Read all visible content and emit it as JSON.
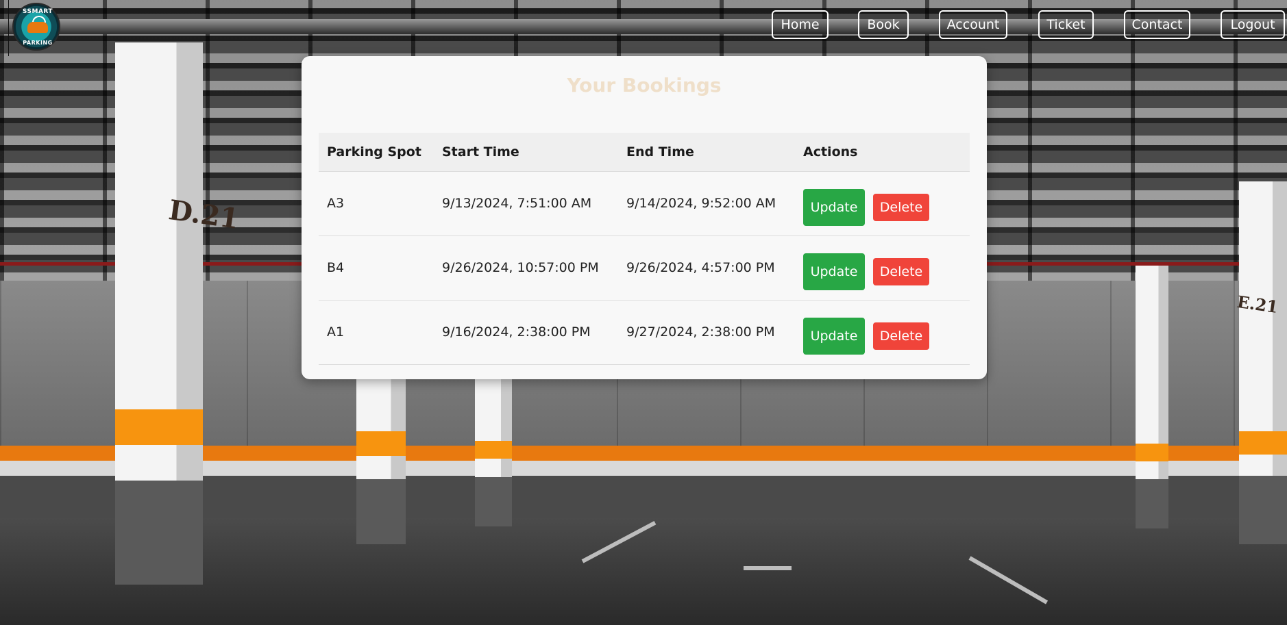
{
  "logo": {
    "text_top": "SSMART",
    "text_bottom": "PARKING",
    "icon": "car-wifi-logo-icon"
  },
  "nav": {
    "items": [
      {
        "label": "Home"
      },
      {
        "label": "Book"
      },
      {
        "label": "Account"
      },
      {
        "label": "Ticket"
      },
      {
        "label": "Contact"
      },
      {
        "label": "Logout"
      }
    ]
  },
  "background": {
    "pillar_labels": [
      "D.21",
      "E.21"
    ]
  },
  "bookings": {
    "title": "Your Bookings",
    "columns": [
      "Parking Spot",
      "Start Time",
      "End Time",
      "Actions"
    ],
    "rows": [
      {
        "spot": "A3",
        "start": "9/13/2024, 7:51:00 AM",
        "end": "9/14/2024, 9:52:00 AM",
        "update_label": "Update",
        "delete_label": "Delete"
      },
      {
        "spot": "B4",
        "start": "9/26/2024, 10:57:00 PM",
        "end": "9/26/2024, 4:57:00 PM",
        "update_label": "Update",
        "delete_label": "Delete"
      },
      {
        "spot": "A1",
        "start": "9/16/2024, 2:38:00 PM",
        "end": "9/27/2024, 2:38:00 PM",
        "update_label": "Update",
        "delete_label": "Delete"
      }
    ]
  },
  "colors": {
    "update_button": "#28a745",
    "delete_button": "#f0443a",
    "title": "#efdfc9",
    "card": "#f8f8f8"
  }
}
